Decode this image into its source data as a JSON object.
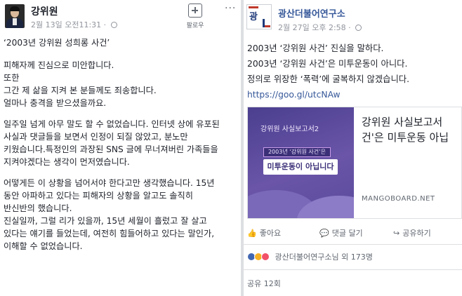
{
  "left_post": {
    "author": "강위원",
    "meta": "2월 13일 오전11:31 · ",
    "follow_label": "팔로우",
    "more_label": "···",
    "title": "‘2003년 강위원 성희롱 사건’",
    "lines": [
      "피해자께 진심으로 미안합니다.",
      "또한",
      "그간 제 삶을 지켜 본 분들께도 죄송합니다.",
      "얼마나 충격을 받으셨을까요.",
      "",
      "일주일 넘게 아무 말도 할 수 없었습니다. 인터넷 상에 유포된",
      "사실과 댓글들을 보면서 인정이 되질 않았고, 분노만",
      "키웠습니다.특정인의 과장된 SNS 글에 무너져버린 가족들을",
      "지켜야겠다는 생각이 먼저였습니다.",
      "",
      "어떻게든 이 상황을 넘어서야 한다고만 생각했습니다. 15년",
      "동안 아파하고 있다는 피해자의 상황을 알고도 솔직히",
      "반신반의 했습니다.",
      "진실일까, 그럴 리가 있을까, 15년 세월이 흘렀고 잘 살고",
      "있다는 얘기를 들었는데, 여전히 힘들어하고 있다는 말인가,",
      "이해할 수 없었습니다."
    ]
  },
  "right_post": {
    "page_name": "광산더불어연구소",
    "meta": "2월 27일 오후 2:58 · ",
    "lines": [
      "2003년 ‘강위원 사건’ 진실을 말하다.",
      "2003년 ‘강위원 사건’은 미투운동이 아니다.",
      "정의로 위장한 ‘폭력’에 굴복하지 않겠습니다."
    ],
    "link": "https://goo.gl/utcNAw",
    "card": {
      "kicker": "강위원 사실보고서2",
      "tag": "2003년 ‘강위원 사건’은",
      "main": "미투운동이 아닙니다",
      "title_line1": "강위원 사실보고서",
      "title_line2": "건'은 미투운동 아닙",
      "domain": "MANGOBOARD.NET"
    },
    "actions": {
      "like": "좋아요",
      "comment": "댓글 달기",
      "share": "공유하기"
    },
    "reactions_text": "광산더불어연구소님 외 173명",
    "shares_text": "공유 12회"
  },
  "icons": {
    "like": "thumbs-up-icon",
    "comment": "comment-icon",
    "share": "share-icon",
    "globe": "globe-icon",
    "follow": "follow-plus-icon"
  },
  "colors": {
    "link": "#365899",
    "meta": "#90949c",
    "card_purple": "#5a4a9c",
    "like_blue": "#4267b2"
  }
}
